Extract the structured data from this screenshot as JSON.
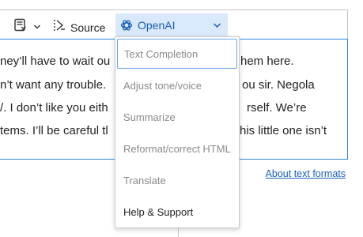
{
  "toolbar": {
    "source_label": "Source",
    "ai_dropdown_label": "OpenAI"
  },
  "editor": {
    "lines": [
      "ney’ll have to wait ou",
      "n’t want any trouble.",
      "/. I don’t like you eith",
      "tems. I’ll be careful tl",
      "hem here.",
      "ou sir. Negola",
      "rself. We’re",
      "his little one isn’t"
    ]
  },
  "menu": {
    "items": [
      {
        "label": "Text Completion",
        "enabled": false,
        "focused": true
      },
      {
        "label": "Adjust tone/voice",
        "enabled": false
      },
      {
        "label": "Summarize",
        "enabled": false
      },
      {
        "label": "Reformat/correct HTML",
        "enabled": false
      },
      {
        "label": "Translate",
        "enabled": false
      },
      {
        "label": "Help & Support",
        "enabled": true
      }
    ]
  },
  "footer": {
    "about_formats_label": "About text formats"
  },
  "colors": {
    "accent": "#2f86d9",
    "dropdown_bg": "#d9e8fb",
    "link": "#1a5fb4",
    "disabled_text": "#8a8a8a"
  }
}
